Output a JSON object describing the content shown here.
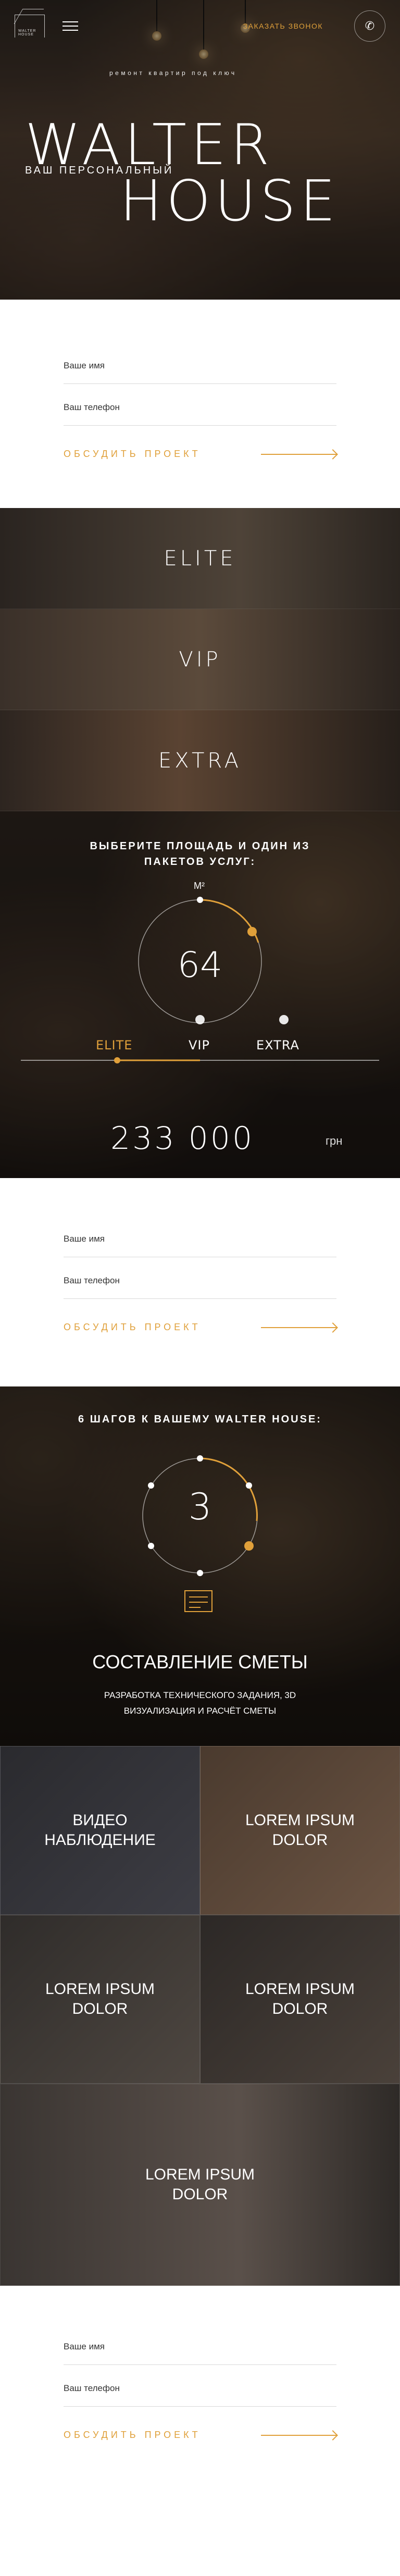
{
  "header": {
    "logo_text": "WALTER HOUSE",
    "callback_label": "ЗАКАЗАТЬ ЗВОНОК",
    "tagline": "ремонт квартир под ключ",
    "title_line1": "WALTER",
    "title_line2": "HOUSE",
    "subtitle": "ВАШ ПЕРСОНАЛЬНЫЙ"
  },
  "form": {
    "name_placeholder": "Ваше имя",
    "phone_placeholder": "Ваш телефон",
    "cta_label": "ОБСУДИТЬ ПРОЕКТ"
  },
  "packages": [
    "ELITE",
    "VIP",
    "EXTRA"
  ],
  "calculator": {
    "title_line1": "ВЫБЕРИТЕ ПЛОЩАДЬ И ОДИН ИЗ",
    "title_line2": "ПАКЕТОВ УСЛУГ:",
    "unit": "М²",
    "area": "64",
    "tabs": [
      "ELITE",
      "VIP",
      "EXTRA"
    ],
    "active_tab": "ELITE",
    "price": "233 000",
    "currency": "грн",
    "accent": "#e0a03a"
  },
  "steps": {
    "title": "6 ШАГОВ К ВАШЕМУ WALTER HOUSE:",
    "current": "3",
    "step_title": "СОСТАВЛЕНИЕ СМЕТЫ",
    "step_desc": "РАЗРАБОТКА ТЕХНИЧЕСКОГО ЗАДАНИЯ, 3D ВИЗУАЛИЗАЦИЯ И РАСЧЁТ СМЕТЫ"
  },
  "services": [
    "ВИДЕО НАБЛЮДЕНИЕ",
    "LOREM IPSUM DOLOR",
    "LOREM IPSUM DOLOR",
    "LOREM IPSUM DOLOR",
    "LOREM IPSUM DOLOR"
  ]
}
